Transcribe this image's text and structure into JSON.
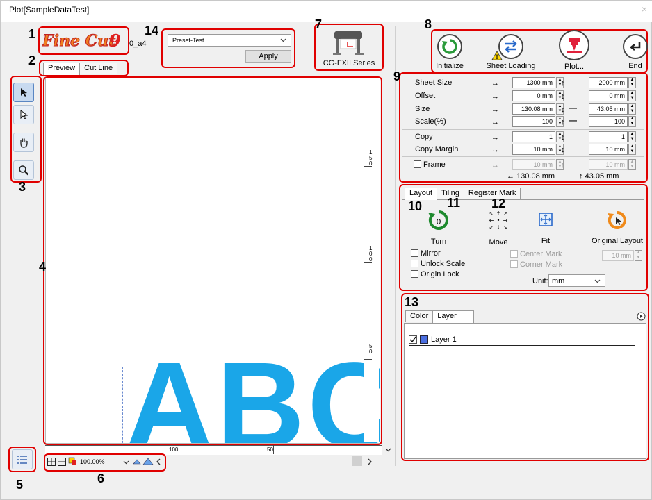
{
  "window": {
    "title": "Plot[SampleDataTest]",
    "close_glyph": "×"
  },
  "logo": {
    "text": "FineCut9",
    "version_suffix": ".0_a4"
  },
  "preset": {
    "selected": "Preset-Test",
    "apply_label": "Apply"
  },
  "device": {
    "name": "CG-FXII Series"
  },
  "toolbar": {
    "initialize_label": "Initialize",
    "sheet_loading_label": "Sheet Loading",
    "plot_label": "Plot...",
    "end_label": "End"
  },
  "view_tabs": [
    {
      "label": "Preview"
    },
    {
      "label": "Cut Line"
    }
  ],
  "params": {
    "sheet_size": {
      "label": "Sheet Size",
      "w": "1300 mm",
      "h": "2000 mm"
    },
    "offset": {
      "label": "Offset",
      "w": "0 mm",
      "h": "0 mm"
    },
    "size": {
      "label": "Size",
      "w": "130.08 mm",
      "h": "43.05 mm"
    },
    "scale": {
      "label": "Scale(%)",
      "w": "100",
      "h": "100"
    },
    "copy": {
      "label": "Copy",
      "w": "1",
      "h": "1"
    },
    "copy_margin": {
      "label": "Copy Margin",
      "w": "10 mm",
      "h": "10 mm"
    },
    "frame": {
      "label": "Frame",
      "w": "10 mm",
      "h": "10 mm"
    },
    "total_w": "↔ 130.08 mm",
    "total_h": "↕ 43.05 mm"
  },
  "layout_tabs": [
    {
      "label": "Layout"
    },
    {
      "label": "Tiling"
    },
    {
      "label": "Register Mark"
    }
  ],
  "layout": {
    "turn_label": "Turn",
    "turn_value": "0",
    "move_label": "Move",
    "fit_label": "Fit",
    "original_layout_label": "Original Layout",
    "mirror_label": "Mirror",
    "unlock_scale_label": "Unlock Scale",
    "origin_lock_label": "Origin Lock",
    "center_mark_label": "Center Mark",
    "corner_mark_label": "Corner Mark",
    "mark_size": "10 mm",
    "unit_label": "Unit:",
    "unit_value": "mm"
  },
  "layer_tabs": [
    {
      "label": "Color"
    },
    {
      "label": "Layer"
    }
  ],
  "layers": [
    {
      "name": "Layer 1",
      "checked": true,
      "color": "#4a6ee0"
    }
  ],
  "preview": {
    "sample_text": "ABC",
    "text_color": "#1aa6e8",
    "zoom": "100.00%",
    "ruler_v": [
      "1\n5\n0",
      "1\n0\n0",
      "5\n0"
    ],
    "ruler_h": [
      "100",
      "50"
    ]
  },
  "callouts": [
    "1",
    "2",
    "3",
    "4",
    "5",
    "6",
    "7",
    "8",
    "9",
    "10",
    "11",
    "12",
    "13",
    "14"
  ],
  "colors": {
    "callout": "#e00000",
    "accent": "#1aa6e8"
  }
}
